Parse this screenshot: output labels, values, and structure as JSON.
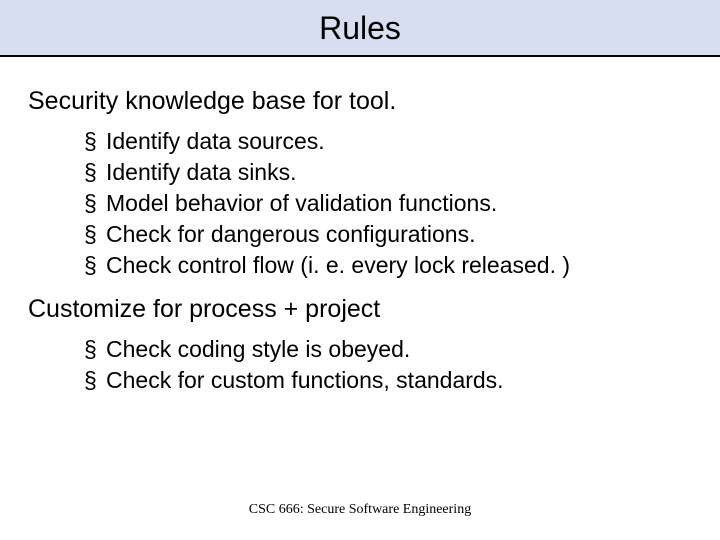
{
  "title": "Rules",
  "sections": [
    {
      "heading": "Security knowledge base for tool.",
      "bullets": [
        "Identify data sources.",
        "Identify data sinks.",
        "Model behavior of validation functions.",
        "Check for dangerous configurations.",
        "Check control flow (i. e. every lock released. )"
      ]
    },
    {
      "heading": "Customize for process + project",
      "bullets": [
        "Check coding style is obeyed.",
        "Check for custom functions, standards."
      ]
    }
  ],
  "footer": "CSC 666: Secure Software Engineering",
  "bullet_glyph": "§"
}
